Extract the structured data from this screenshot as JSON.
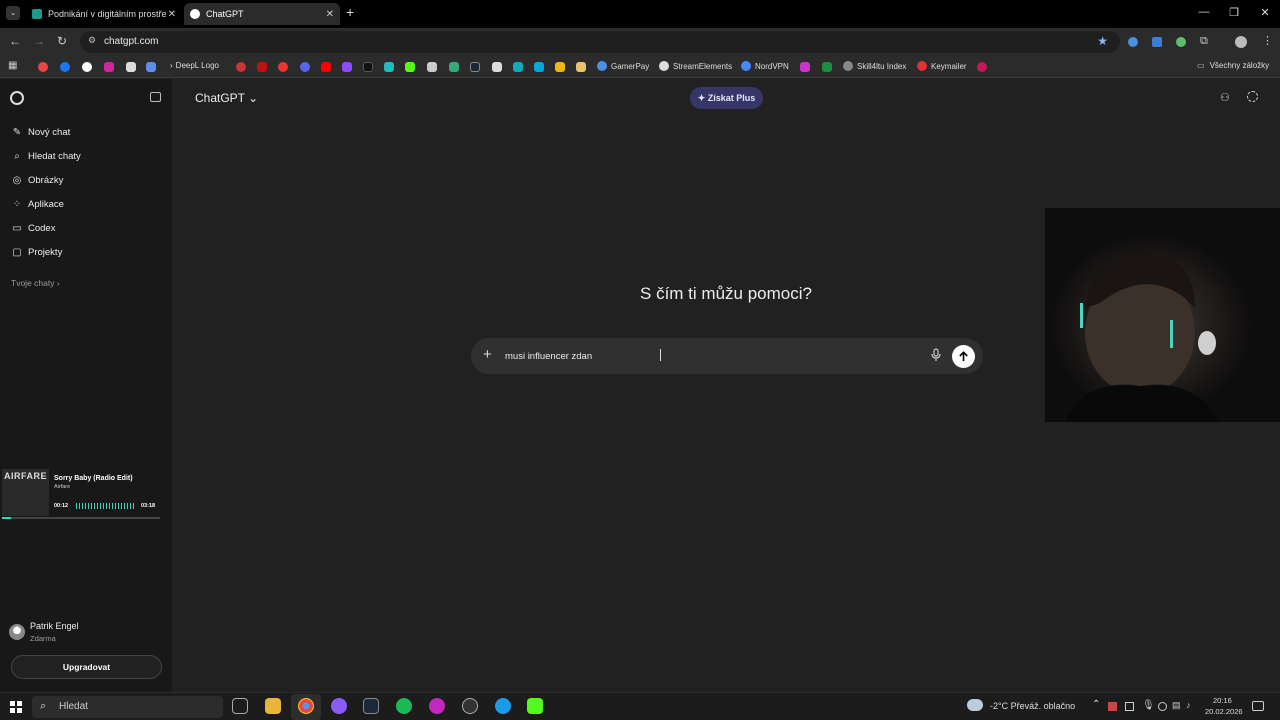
{
  "browser": {
    "tabs": [
      {
        "title": "Podnikání v digitálním prostředí",
        "active": false
      },
      {
        "title": "ChatGPT",
        "active": true
      }
    ],
    "url": "chatgpt.com",
    "bookmarks": [
      {
        "label": "DeepL Logo"
      },
      {
        "label": "GamerPay"
      },
      {
        "label": "StreamElements"
      },
      {
        "label": "NordVPN"
      },
      {
        "label": "Skill4ltu Index"
      },
      {
        "label": "Keymailer"
      },
      {
        "label": "Všechny záložky"
      }
    ]
  },
  "sidebar": {
    "items": [
      {
        "label": "Nový chat",
        "icon": "edit-icon"
      },
      {
        "label": "Hledat chaty",
        "icon": "search-icon"
      },
      {
        "label": "Obrázky",
        "icon": "image-icon"
      },
      {
        "label": "Aplikace",
        "icon": "apps-icon"
      },
      {
        "label": "Codex",
        "icon": "codex-icon"
      },
      {
        "label": "Projekty",
        "icon": "folder-icon"
      }
    ],
    "your_chats": "Tvoje chaty ›",
    "user": {
      "name": "Patrik Engel",
      "plan": "Zdarma"
    },
    "upgrade_label": "Upgradovat"
  },
  "player": {
    "album_text": "AIRFARE",
    "song": "Sorry Baby (Radio Edit)",
    "artist": "Airfare",
    "time_current": "00:12",
    "time_total": "03:18",
    "progress": 0.06
  },
  "main": {
    "model": "ChatGPT ⌄",
    "plus_label": "✦ Získat Plus",
    "heading": "S čím ti můžu pomoci?",
    "composer_text": "musi influencer zdan"
  },
  "taskbar": {
    "search_label": "Hledat",
    "weather": "-2°C  Převáž. oblačno",
    "time": "20:16",
    "date": "20.02.2026"
  },
  "colors": {
    "accent_plus": "#373669",
    "background": "#212121",
    "sidebar": "#181818"
  }
}
